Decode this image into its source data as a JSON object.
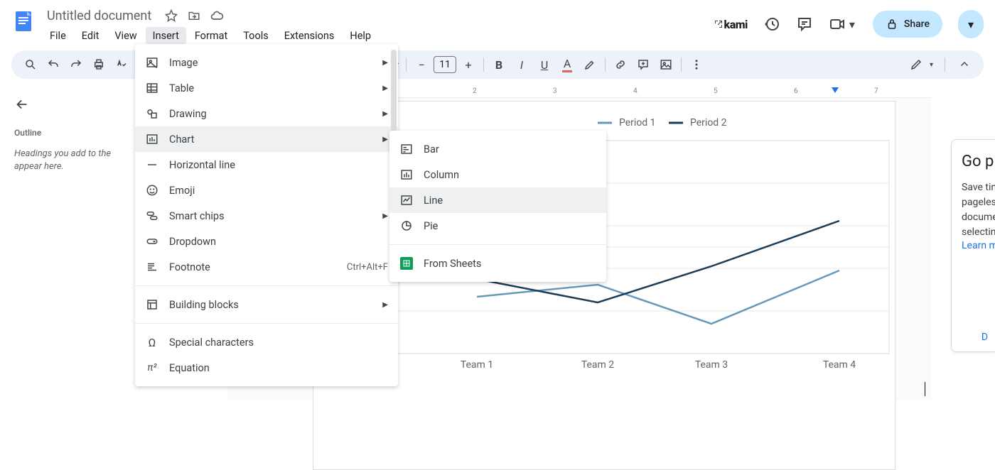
{
  "doc_title": "Untitled document",
  "menubar": [
    "File",
    "Edit",
    "View",
    "Insert",
    "Format",
    "Tools",
    "Extensions",
    "Help"
  ],
  "active_menu": "Insert",
  "kami_label": "kami",
  "share_label": "Share",
  "toolbar": {
    "font_size": "11"
  },
  "outline": {
    "title": "Outline",
    "hint": "Headings you add to the appear here."
  },
  "ruler_ticks": [
    "2",
    "3",
    "4",
    "5",
    "6",
    "7"
  ],
  "insert_menu": {
    "items": [
      {
        "label": "Image",
        "icon": "image",
        "arrow": true
      },
      {
        "label": "Table",
        "icon": "table",
        "arrow": true
      },
      {
        "label": "Drawing",
        "icon": "drawing",
        "arrow": true
      },
      {
        "label": "Chart",
        "icon": "chart",
        "arrow": true,
        "hover": true
      },
      {
        "label": "Horizontal line",
        "icon": "hline"
      },
      {
        "label": "Emoji",
        "icon": "emoji"
      },
      {
        "label": "Smart chips",
        "icon": "chips",
        "arrow": true
      },
      {
        "label": "Dropdown",
        "icon": "dropdown"
      },
      {
        "label": "Footnote",
        "icon": "footnote",
        "shortcut": "Ctrl+Alt+F"
      }
    ],
    "group2": [
      {
        "label": "Building blocks",
        "icon": "blocks",
        "arrow": true
      }
    ],
    "group3": [
      {
        "label": "Special characters",
        "icon": "omega"
      },
      {
        "label": "Equation",
        "icon": "pi"
      }
    ]
  },
  "chart_submenu": {
    "items": [
      {
        "label": "Bar",
        "icon": "bar"
      },
      {
        "label": "Column",
        "icon": "column"
      },
      {
        "label": "Line",
        "icon": "line",
        "hover": true
      },
      {
        "label": "Pie",
        "icon": "pie"
      }
    ],
    "from_sheets": "From Sheets"
  },
  "right_panel": {
    "title": "Go p",
    "lines": [
      "Save tin",
      "pageles",
      "docume",
      "selectin"
    ],
    "link": "Learn m",
    "dismiss": "D"
  },
  "chart_data": {
    "type": "line",
    "categories": [
      "Team 1",
      "Team 2",
      "Team 3",
      "Team 4"
    ],
    "series": [
      {
        "name": "Period 1",
        "color": "#6699b8",
        "values": [
          26,
          30,
          22,
          32
        ]
      },
      {
        "name": "Period 2",
        "color": "#1c3d5a",
        "values": [
          30,
          26,
          33,
          42
        ]
      }
    ],
    "xlabel": "",
    "ylabel": "",
    "ylim": [
      0,
      50
    ],
    "legend_position": "top"
  }
}
